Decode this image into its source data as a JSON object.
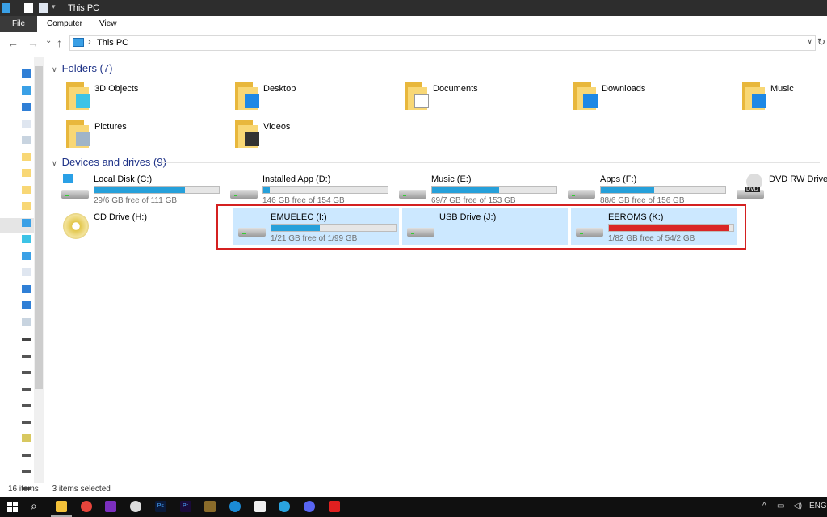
{
  "window": {
    "title": "This PC"
  },
  "ribbon": {
    "tabs": [
      "File",
      "Computer",
      "View"
    ]
  },
  "address": {
    "path": "This PC",
    "separator": "›"
  },
  "nav": {
    "back": "←",
    "forward": "→",
    "recent": "⌄",
    "up": "↑",
    "refresh": "↻",
    "dropdown": "∨"
  },
  "groups": {
    "folders": {
      "title": "Folders (7)"
    },
    "devices": {
      "title": "Devices and drives (9)"
    }
  },
  "folders": [
    {
      "label": "3D Objects",
      "icon": "3d-objects-icon",
      "color": "#3cc3e6"
    },
    {
      "label": "Desktop",
      "icon": "desktop-icon",
      "color": "#1e88e5"
    },
    {
      "label": "Documents",
      "icon": "documents-icon",
      "color": "#ffffff"
    },
    {
      "label": "Downloads",
      "icon": "downloads-icon",
      "color": "#1e88e5"
    },
    {
      "label": "Music",
      "icon": "music-icon",
      "color": "#1e88e5"
    },
    {
      "label": "Pictures",
      "icon": "pictures-icon",
      "color": "#9fb4c8"
    },
    {
      "label": "Videos",
      "icon": "videos-icon",
      "color": "#333333"
    }
  ],
  "drives": [
    {
      "label": "Local Disk (C:)",
      "free": "29/6 GB free of 111 GB",
      "used_fraction": 0.73,
      "icon": "system-drive-icon",
      "selected": false
    },
    {
      "label": "Installed App (D:)",
      "free": "146 GB free of 154 GB",
      "used_fraction": 0.05,
      "icon": "hard-drive-icon",
      "selected": false
    },
    {
      "label": "Music (E:)",
      "free": "69/7 GB free of 153 GB",
      "used_fraction": 0.54,
      "icon": "hard-drive-icon",
      "selected": false
    },
    {
      "label": "Apps (F:)",
      "free": "88/6 GB free of 156 GB",
      "used_fraction": 0.43,
      "icon": "hard-drive-icon",
      "selected": false
    },
    {
      "label": "DVD RW Drive (G:)",
      "icon": "dvd-drive-icon",
      "badge": "DVD",
      "selected": false
    },
    {
      "label": "CD Drive (H:)",
      "icon": "cd-drive-icon",
      "selected": false
    },
    {
      "label": "EMUELEC (I:)",
      "free": "1/21 GB free of 1/99 GB",
      "used_fraction": 0.39,
      "icon": "hard-drive-icon",
      "selected": true
    },
    {
      "label": "USB Drive (J:)",
      "icon": "usb-drive-icon",
      "selected": true
    },
    {
      "label": "EEROMS (K:)",
      "free": "1/82 GB free of 54/2 GB",
      "used_fraction": 0.97,
      "icon": "hard-drive-icon",
      "selected": true,
      "full": true
    }
  ],
  "status": {
    "items": "16 items",
    "selected": "3 items selected"
  },
  "taskbar": {
    "apps": [
      {
        "name": "file-explorer",
        "color": "#f3c13a"
      },
      {
        "name": "chrome",
        "color": "#e8453c"
      },
      {
        "name": "app-purple",
        "color": "#7b2fbe"
      },
      {
        "name": "obs",
        "color": "#dddddd"
      },
      {
        "name": "photoshop",
        "color": "#0a1a3a",
        "text": "Ps"
      },
      {
        "name": "premiere",
        "color": "#1a0a3a",
        "text": "Pr"
      },
      {
        "name": "game-app",
        "color": "#8a6b2a"
      },
      {
        "name": "app-v",
        "color": "#1b8bd6"
      },
      {
        "name": "app-white",
        "color": "#f0f0f0"
      },
      {
        "name": "telegram",
        "color": "#2aa3df"
      },
      {
        "name": "discord",
        "color": "#5865f2"
      },
      {
        "name": "youtube",
        "color": "#e02020"
      }
    ],
    "tray": {
      "chevron": "^",
      "language": "ENG"
    }
  },
  "colors": {
    "accent": "#26a0da",
    "full": "#da2626",
    "selection": "#cce8ff",
    "highlight_box": "#d42020"
  }
}
